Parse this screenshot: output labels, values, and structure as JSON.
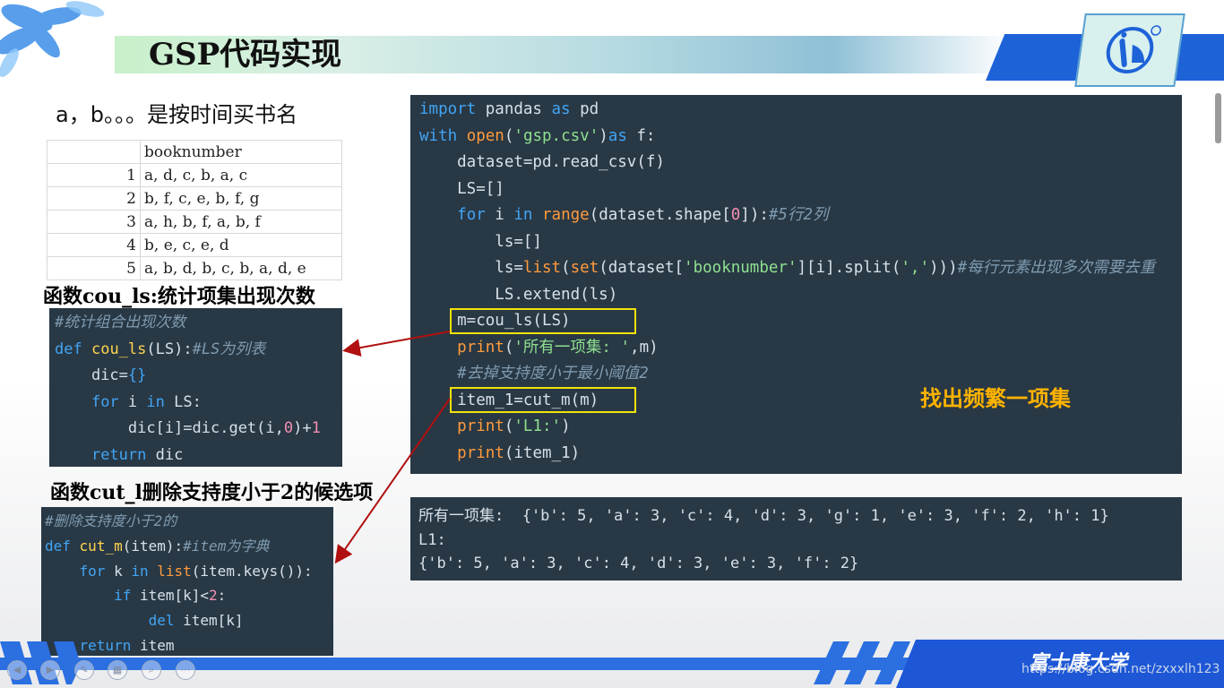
{
  "slide": {
    "title": "GSP代码实现",
    "subtitle": "a，b。。。是按时间买书名",
    "table": {
      "header": "booknumber",
      "rows": [
        {
          "idx": "1",
          "value": "a, d, c, b, a, c"
        },
        {
          "idx": "2",
          "value": "b, f, c, e, b, f, g"
        },
        {
          "idx": "3",
          "value": "a, h, b, f, a, b, f"
        },
        {
          "idx": "4",
          "value": "b, e, c, e, d"
        },
        {
          "idx": "5",
          "value": "a, b, d, b, c, b, a, d, e"
        }
      ]
    },
    "label_count": "函数cou_ls:统计项集出现次数",
    "label_cut": "函数cut_l删除支持度小于2的候选项",
    "annotation": "找出频繁一项集",
    "university": "富士康大学",
    "watermark": "https://blog.csdn.net/zxxxlh123",
    "output": {
      "line1": "所有一项集:  {'b': 5, 'a': 3, 'c': 4, 'd': 3, 'g': 1, 'e': 3, 'f': 2, 'h': 1}",
      "line2": "L1:",
      "line3": "{'b': 5, 'a': 3, 'c': 4, 'd': 3, 'e': 3, 'f': 2}"
    },
    "nav_icons": [
      "prev-icon",
      "next-icon",
      "pen-icon",
      "grid-icon",
      "zoom-icon",
      "more-icon"
    ],
    "colors": {
      "accent_blue": "#1e62d8",
      "code_bg": "#283845",
      "highlight": "#f2e20d",
      "annotation": "#ffb300",
      "arrow": "#b01010"
    }
  }
}
